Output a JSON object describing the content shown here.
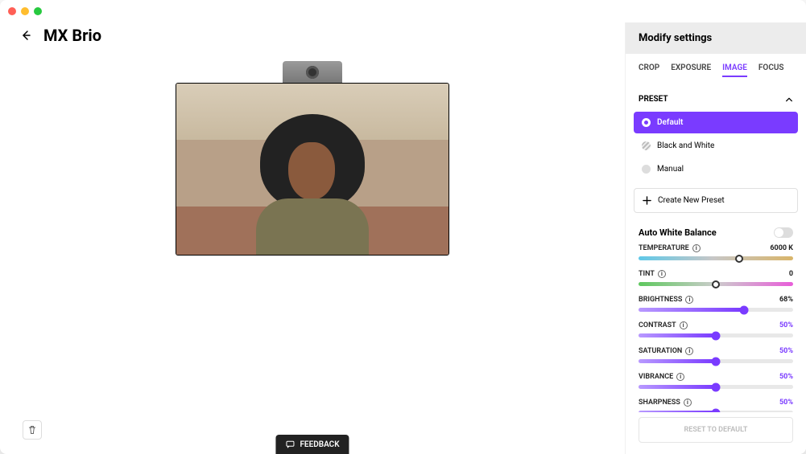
{
  "header": {
    "title": "MX Brio"
  },
  "feedback": {
    "label": "FEEDBACK"
  },
  "panel": {
    "title": "Modify settings",
    "tabs": [
      "CROP",
      "EXPOSURE",
      "IMAGE",
      "FOCUS"
    ],
    "active_tab": "IMAGE",
    "preset_label": "PRESET",
    "presets": [
      {
        "name": "Default",
        "selected": true
      },
      {
        "name": "Black and White",
        "selected": false
      },
      {
        "name": "Manual",
        "selected": false
      }
    ],
    "create_preset": "Create New Preset",
    "awb_label": "Auto White Balance",
    "awb_enabled": false,
    "sliders": {
      "temperature": {
        "label": "TEMPERATURE",
        "value_text": "6000 K",
        "percent": 65,
        "type": "temp"
      },
      "tint": {
        "label": "TINT",
        "value_text": "0",
        "percent": 50,
        "type": "tint"
      },
      "brightness": {
        "label": "BRIGHTNESS",
        "value_text": "68%",
        "percent": 68,
        "type": "purple"
      },
      "contrast": {
        "label": "CONTRAST",
        "value_text": "50%",
        "percent": 50,
        "type": "purple"
      },
      "saturation": {
        "label": "SATURATION",
        "value_text": "50%",
        "percent": 50,
        "type": "purple"
      },
      "vibrance": {
        "label": "VIBRANCE",
        "value_text": "50%",
        "percent": 50,
        "type": "purple"
      },
      "sharpness": {
        "label": "SHARPNESS",
        "value_text": "50%",
        "percent": 50,
        "type": "purple"
      }
    },
    "reset": "RESET TO DEFAULT"
  }
}
